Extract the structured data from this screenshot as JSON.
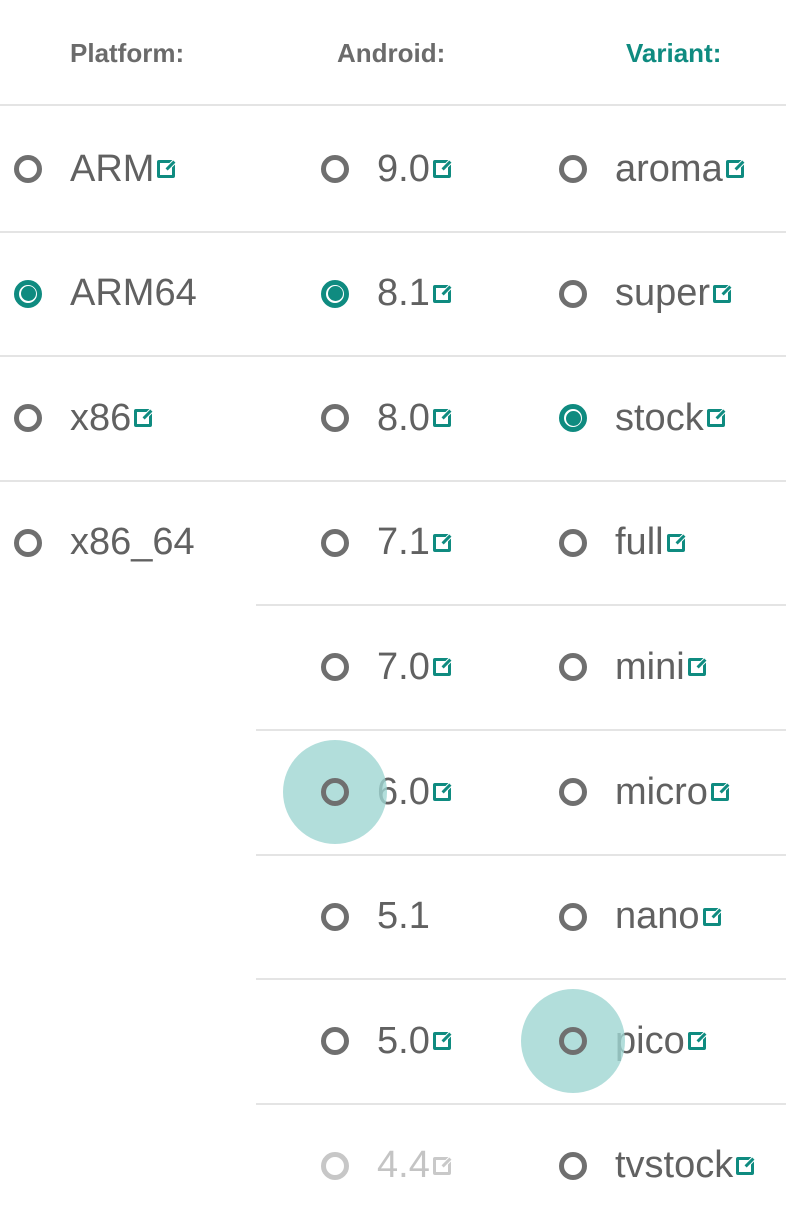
{
  "header": {
    "platform": "Platform:",
    "android": "Android:",
    "variant": "Variant:"
  },
  "colors": {
    "accent": "#0f8b80",
    "ripple": "#9fd6d2",
    "text": "#616161",
    "disabled": "#c4c4c4"
  },
  "platform": [
    {
      "label": "ARM",
      "link": true,
      "checked": false
    },
    {
      "label": "ARM64",
      "link": false,
      "checked": true
    },
    {
      "label": "x86",
      "link": true,
      "checked": false
    },
    {
      "label": "x86_64",
      "link": false,
      "checked": false
    }
  ],
  "android": [
    {
      "label": "9.0",
      "link": true,
      "checked": false
    },
    {
      "label": "8.1",
      "link": true,
      "checked": true
    },
    {
      "label": "8.0",
      "link": true,
      "checked": false
    },
    {
      "label": "7.1",
      "link": true,
      "checked": false
    },
    {
      "label": "7.0",
      "link": true,
      "checked": false
    },
    {
      "label": "6.0",
      "link": true,
      "checked": false,
      "pressed": true
    },
    {
      "label": "5.1",
      "link": false,
      "checked": false
    },
    {
      "label": "5.0",
      "link": true,
      "checked": false
    },
    {
      "label": "4.4",
      "link": true,
      "checked": false,
      "disabled": true
    }
  ],
  "variant": [
    {
      "label": "aroma",
      "link": true,
      "checked": false
    },
    {
      "label": "super",
      "link": true,
      "checked": false
    },
    {
      "label": "stock",
      "link": true,
      "checked": true
    },
    {
      "label": "full",
      "link": true,
      "checked": false
    },
    {
      "label": "mini",
      "link": true,
      "checked": false
    },
    {
      "label": "micro",
      "link": true,
      "checked": false
    },
    {
      "label": "nano",
      "link": true,
      "checked": false
    },
    {
      "label": "pico",
      "link": true,
      "checked": false,
      "pressed": true
    },
    {
      "label": "tvstock",
      "link": true,
      "checked": false
    }
  ],
  "icons": {
    "radio": "radio-button-icon",
    "link": "external-link-icon"
  }
}
